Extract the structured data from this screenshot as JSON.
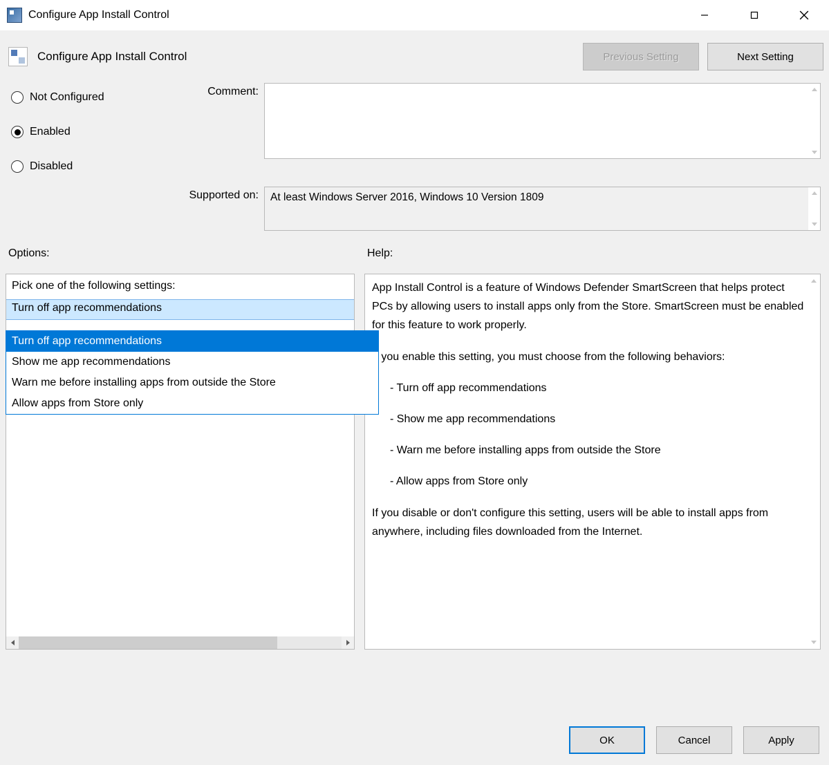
{
  "window": {
    "title": "Configure App Install Control"
  },
  "header": {
    "policy_name": "Configure App Install Control",
    "prev_label": "Previous Setting",
    "next_label": "Next Setting"
  },
  "state": {
    "radios": {
      "not_configured": "Not Configured",
      "enabled": "Enabled",
      "disabled": "Disabled",
      "selected": "enabled"
    },
    "comment_label": "Comment:",
    "comment_value": "",
    "supported_label": "Supported on:",
    "supported_value": "At least Windows Server 2016, Windows 10 Version 1809"
  },
  "labels": {
    "options": "Options:",
    "help": "Help:"
  },
  "options": {
    "heading": "Pick one of the following settings:",
    "selected": "Turn off app recommendations",
    "items": [
      "Turn off app recommendations",
      "Show me app recommendations",
      "Warn me before installing apps from outside the Store",
      "Allow apps from Store only"
    ]
  },
  "help": {
    "p1": "App Install Control is a feature of Windows Defender SmartScreen that helps protect PCs by allowing users to install apps only from the Store.  SmartScreen must be enabled for this feature to work properly.",
    "p2": "If you enable this setting, you must choose from the following behaviors:",
    "b1": "- Turn off app recommendations",
    "b2": "- Show me app recommendations",
    "b3": "- Warn me before installing apps from outside the Store",
    "b4": "- Allow apps from Store only",
    "p3": "If you disable or don't configure this setting, users will be able to install apps from anywhere, including files downloaded from the Internet."
  },
  "buttons": {
    "ok": "OK",
    "cancel": "Cancel",
    "apply": "Apply"
  }
}
